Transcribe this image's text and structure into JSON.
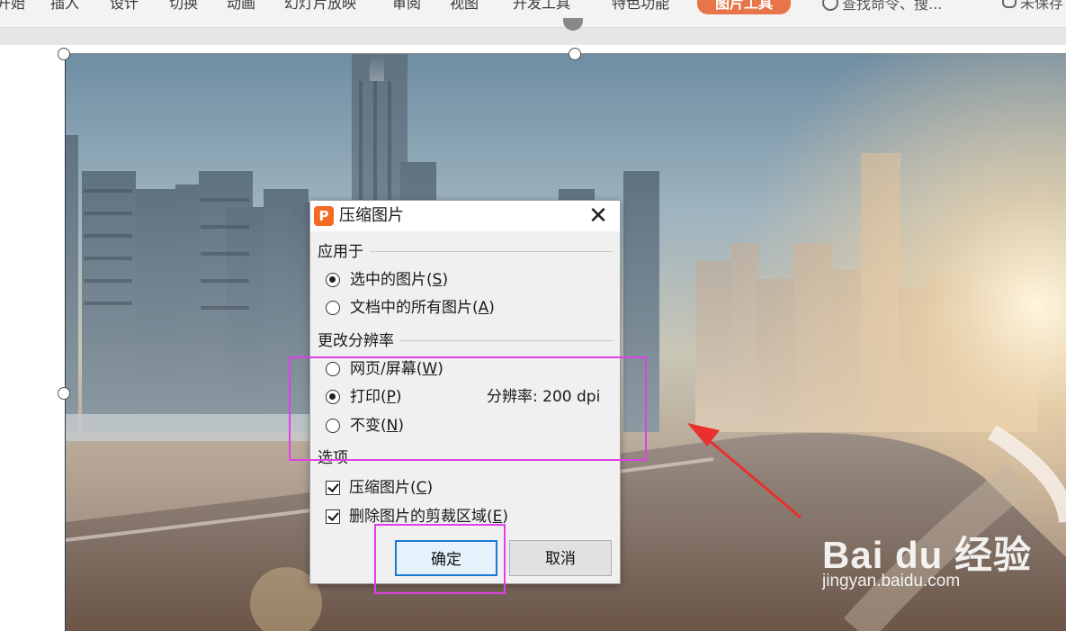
{
  "ribbon": {
    "tabs": [
      "开始",
      "插入",
      "设计",
      "切换",
      "动画",
      "幻灯片放映",
      "审阅",
      "视图",
      "开发工具",
      "特色功能"
    ],
    "active_tab": "图片工具",
    "search_placeholder": "查找命令、搜...",
    "status": "未保存"
  },
  "dialog": {
    "title": "压缩图片",
    "close_glyph": "✕",
    "apply_to": {
      "label": "应用于",
      "options": [
        {
          "text": "选中的图片(",
          "key": "S",
          "selected": true
        },
        {
          "text": "文档中的所有图片(",
          "key": "A",
          "selected": false
        }
      ]
    },
    "resolution": {
      "label": "更改分辨率",
      "options": [
        {
          "text": "网页/屏幕(",
          "key": "W",
          "selected": false
        },
        {
          "text": "打印(",
          "key": "P",
          "selected": true
        },
        {
          "text": "不变(",
          "key": "N",
          "selected": false
        }
      ],
      "value_label": "分辨率:",
      "value": "200 dpi"
    },
    "options": {
      "label": "选项",
      "checks": [
        {
          "text": "压缩图片(",
          "key": "C",
          "checked": true
        },
        {
          "text": "删除图片的剪裁区域(",
          "key": "E",
          "checked": true
        }
      ]
    },
    "ok_label": "确定",
    "cancel_label": "取消"
  },
  "watermark": {
    "logo": "Bai du 经验",
    "url": "jingyan.baidu.com"
  },
  "colors": {
    "accent_tab": "#e8744a",
    "highlight": "#e040e6",
    "arrow": "#e8302c",
    "wps_logo": "#f26b21"
  }
}
